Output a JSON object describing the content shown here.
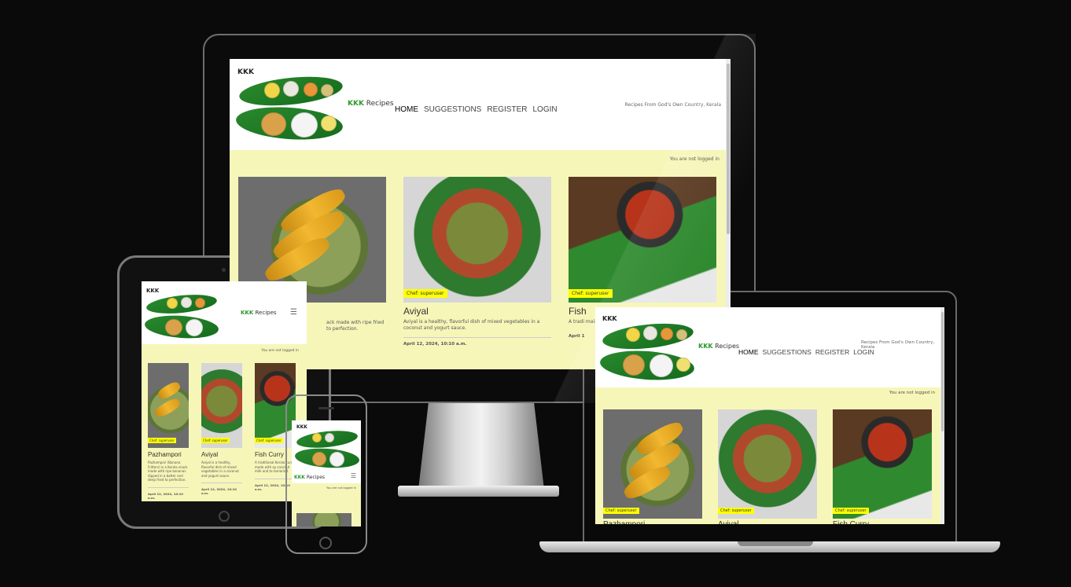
{
  "site": {
    "logo_text": "KKK",
    "brand_k": "KKK",
    "brand_rest": " Recipes",
    "nav": [
      "HOME",
      "SUGGESTIONS",
      "REGISTER",
      "LOGIN"
    ],
    "tagline": "Recipes From God's Own Country, Kerala",
    "status": "You are not logged in"
  },
  "cards": [
    {
      "title": "Pazhampori",
      "chef": "Chef: superuser",
      "desc_full": "Pazhampori (Banana Fritters) is a Kerala snack made with ripe bananas dipped in a batter and deep fried to perfection.",
      "desc_imac": "ack made with ripe fried to perfection.",
      "date": "April 12, 2024, 10:10 a.m."
    },
    {
      "title": "Aviyal",
      "chef": "Chef: superuser",
      "desc_full": "Aviyal is a healthy, flavorful dish of mixed vegetables in a coconut and yogurt sauce.",
      "date": "April 12, 2024, 10:10 a.m."
    },
    {
      "title": "Fish Curry",
      "title_imac": "Fish",
      "chef": "Chef: superuser",
      "desc_full": "A traditional Kerala fish curry made with spices, coconut milk and tamarind.",
      "desc_imac": "A tradi malabar",
      "desc_ipad": "A traditional Kerala curry made with sp coconut milk and ta tamarind.",
      "date": "April 12, 2024, 10:10 a.m.",
      "date_imac": "April 1"
    }
  ],
  "colors": {
    "page_bg": "#f6f6b9",
    "chef_badge": "#ffff00",
    "brand_green": "#2e9a2e"
  }
}
